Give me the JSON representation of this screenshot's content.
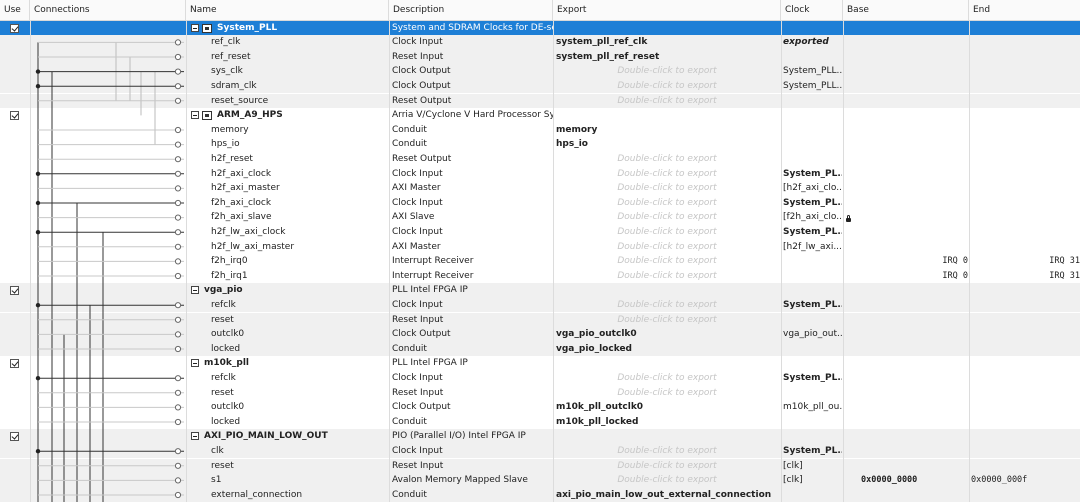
{
  "columns": {
    "use": "Use",
    "connections": "Connections",
    "name": "Name",
    "description": "Description",
    "export": "Export",
    "clock": "Clock",
    "base": "Base",
    "end": "End"
  },
  "colors": {
    "selected": "#1e7fd6",
    "alt_row": "#f0f0f0",
    "hint": "#c6c6c6"
  },
  "rows": [
    {
      "type": "module",
      "name": "System_PLL",
      "icon": "chip-icon",
      "description": "System and SDRAM Clocks for DE-seri...",
      "export": "",
      "clock": "",
      "base": "",
      "end": "",
      "selected": true
    },
    {
      "type": "port",
      "name": "ref_clk",
      "description": "Clock Input",
      "export": "system_pll_ref_clk",
      "clock": "exported",
      "base": "",
      "end": ""
    },
    {
      "type": "port",
      "name": "ref_reset",
      "description": "Reset Input",
      "export": "system_pll_ref_reset",
      "clock": "",
      "base": "",
      "end": ""
    },
    {
      "type": "port",
      "name": "sys_clk",
      "description": "Clock Output",
      "export": "Double-click to export",
      "clock": "System_PLL...",
      "base": "",
      "end": ""
    },
    {
      "type": "port",
      "name": "sdram_clk",
      "description": "Clock Output",
      "export": "Double-click to export",
      "clock": "System_PLL...",
      "base": "",
      "end": ""
    },
    {
      "type": "port",
      "name": "reset_source",
      "description": "Reset Output",
      "export": "Double-click to export",
      "clock": "",
      "base": "",
      "end": ""
    },
    {
      "type": "module",
      "name": "ARM_A9_HPS",
      "icon": "chip-icon",
      "description": "Arria V/Cyclone V Hard Processor System",
      "export": "",
      "clock": "",
      "base": "",
      "end": ""
    },
    {
      "type": "port",
      "name": "memory",
      "description": "Conduit",
      "export": "memory",
      "clock": "",
      "base": "",
      "end": ""
    },
    {
      "type": "port",
      "name": "hps_io",
      "description": "Conduit",
      "export": "hps_io",
      "clock": "",
      "base": "",
      "end": ""
    },
    {
      "type": "port",
      "name": "h2f_reset",
      "description": "Reset Output",
      "export": "Double-click to export",
      "clock": "",
      "base": "",
      "end": ""
    },
    {
      "type": "port",
      "name": "h2f_axi_clock",
      "description": "Clock Input",
      "export": "Double-click to export",
      "clock": "System_PL...",
      "base": "",
      "end": ""
    },
    {
      "type": "port",
      "name": "h2f_axi_master",
      "description": "AXI Master",
      "export": "Double-click to export",
      "clock": "[h2f_axi_clo...",
      "base": "",
      "end": ""
    },
    {
      "type": "port",
      "name": "f2h_axi_clock",
      "description": "Clock Input",
      "export": "Double-click to export",
      "clock": "System_PL...",
      "base": "",
      "end": ""
    },
    {
      "type": "port",
      "name": "f2h_axi_slave",
      "description": "AXI Slave",
      "export": "Double-click to export",
      "clock": "[f2h_axi_clo...",
      "base": "",
      "end": "",
      "lock": true
    },
    {
      "type": "port",
      "name": "h2f_lw_axi_clock",
      "description": "Clock Input",
      "export": "Double-click to export",
      "clock": "System_PL...",
      "base": "",
      "end": ""
    },
    {
      "type": "port",
      "name": "h2f_lw_axi_master",
      "description": "AXI Master",
      "export": "Double-click to export",
      "clock": "[h2f_lw_axi...",
      "base": "",
      "end": ""
    },
    {
      "type": "port",
      "name": "f2h_irq0",
      "description": "Interrupt Receiver",
      "export": "Double-click to export",
      "clock": "",
      "base": "IRQ 0",
      "end": "IRQ 31"
    },
    {
      "type": "port",
      "name": "f2h_irq1",
      "description": "Interrupt Receiver",
      "export": "Double-click to export",
      "clock": "",
      "base": "IRQ 0",
      "end": "IRQ 31"
    },
    {
      "type": "module",
      "name": "vga_pio",
      "icon": "",
      "description": "PLL Intel FPGA IP",
      "export": "",
      "clock": "",
      "base": "",
      "end": ""
    },
    {
      "type": "port",
      "name": "refclk",
      "description": "Clock Input",
      "export": "Double-click to export",
      "clock": "System_PL...",
      "base": "",
      "end": ""
    },
    {
      "type": "port",
      "name": "reset",
      "description": "Reset Input",
      "export": "Double-click to export",
      "clock": "",
      "base": "",
      "end": ""
    },
    {
      "type": "port",
      "name": "outclk0",
      "description": "Clock Output",
      "export": "vga_pio_outclk0",
      "clock": "vga_pio_out...",
      "base": "",
      "end": ""
    },
    {
      "type": "port",
      "name": "locked",
      "description": "Conduit",
      "export": "vga_pio_locked",
      "clock": "",
      "base": "",
      "end": ""
    },
    {
      "type": "module",
      "name": "m10k_pll",
      "icon": "",
      "description": "PLL Intel FPGA IP",
      "export": "",
      "clock": "",
      "base": "",
      "end": ""
    },
    {
      "type": "port",
      "name": "refclk",
      "description": "Clock Input",
      "export": "Double-click to export",
      "clock": "System_PL...",
      "base": "",
      "end": ""
    },
    {
      "type": "port",
      "name": "reset",
      "description": "Reset Input",
      "export": "Double-click to export",
      "clock": "",
      "base": "",
      "end": ""
    },
    {
      "type": "port",
      "name": "outclk0",
      "description": "Clock Output",
      "export": "m10k_pll_outclk0",
      "clock": "m10k_pll_ou...",
      "base": "",
      "end": ""
    },
    {
      "type": "port",
      "name": "locked",
      "description": "Conduit",
      "export": "m10k_pll_locked",
      "clock": "",
      "base": "",
      "end": ""
    },
    {
      "type": "module",
      "name": "AXI_PIO_MAIN_LOW_OUT",
      "icon": "",
      "description": "PIO (Parallel I/O) Intel FPGA IP",
      "export": "",
      "clock": "",
      "base": "",
      "end": ""
    },
    {
      "type": "port",
      "name": "clk",
      "description": "Clock Input",
      "export": "Double-click to export",
      "clock": "System_PL...",
      "base": "",
      "end": ""
    },
    {
      "type": "port",
      "name": "reset",
      "description": "Reset Input",
      "export": "Double-click to export",
      "clock": "[clk]",
      "base": "",
      "end": ""
    },
    {
      "type": "port",
      "name": "s1",
      "description": "Avalon Memory Mapped Slave",
      "export": "Double-click to export",
      "clock": "[clk]",
      "base": "0x0000_0000",
      "end": "0x0000_000f"
    },
    {
      "type": "port",
      "name": "external_connection",
      "description": "Conduit",
      "export": "axi_pio_main_low_out_external_connection",
      "clock": "",
      "base": "",
      "end": ""
    }
  ]
}
